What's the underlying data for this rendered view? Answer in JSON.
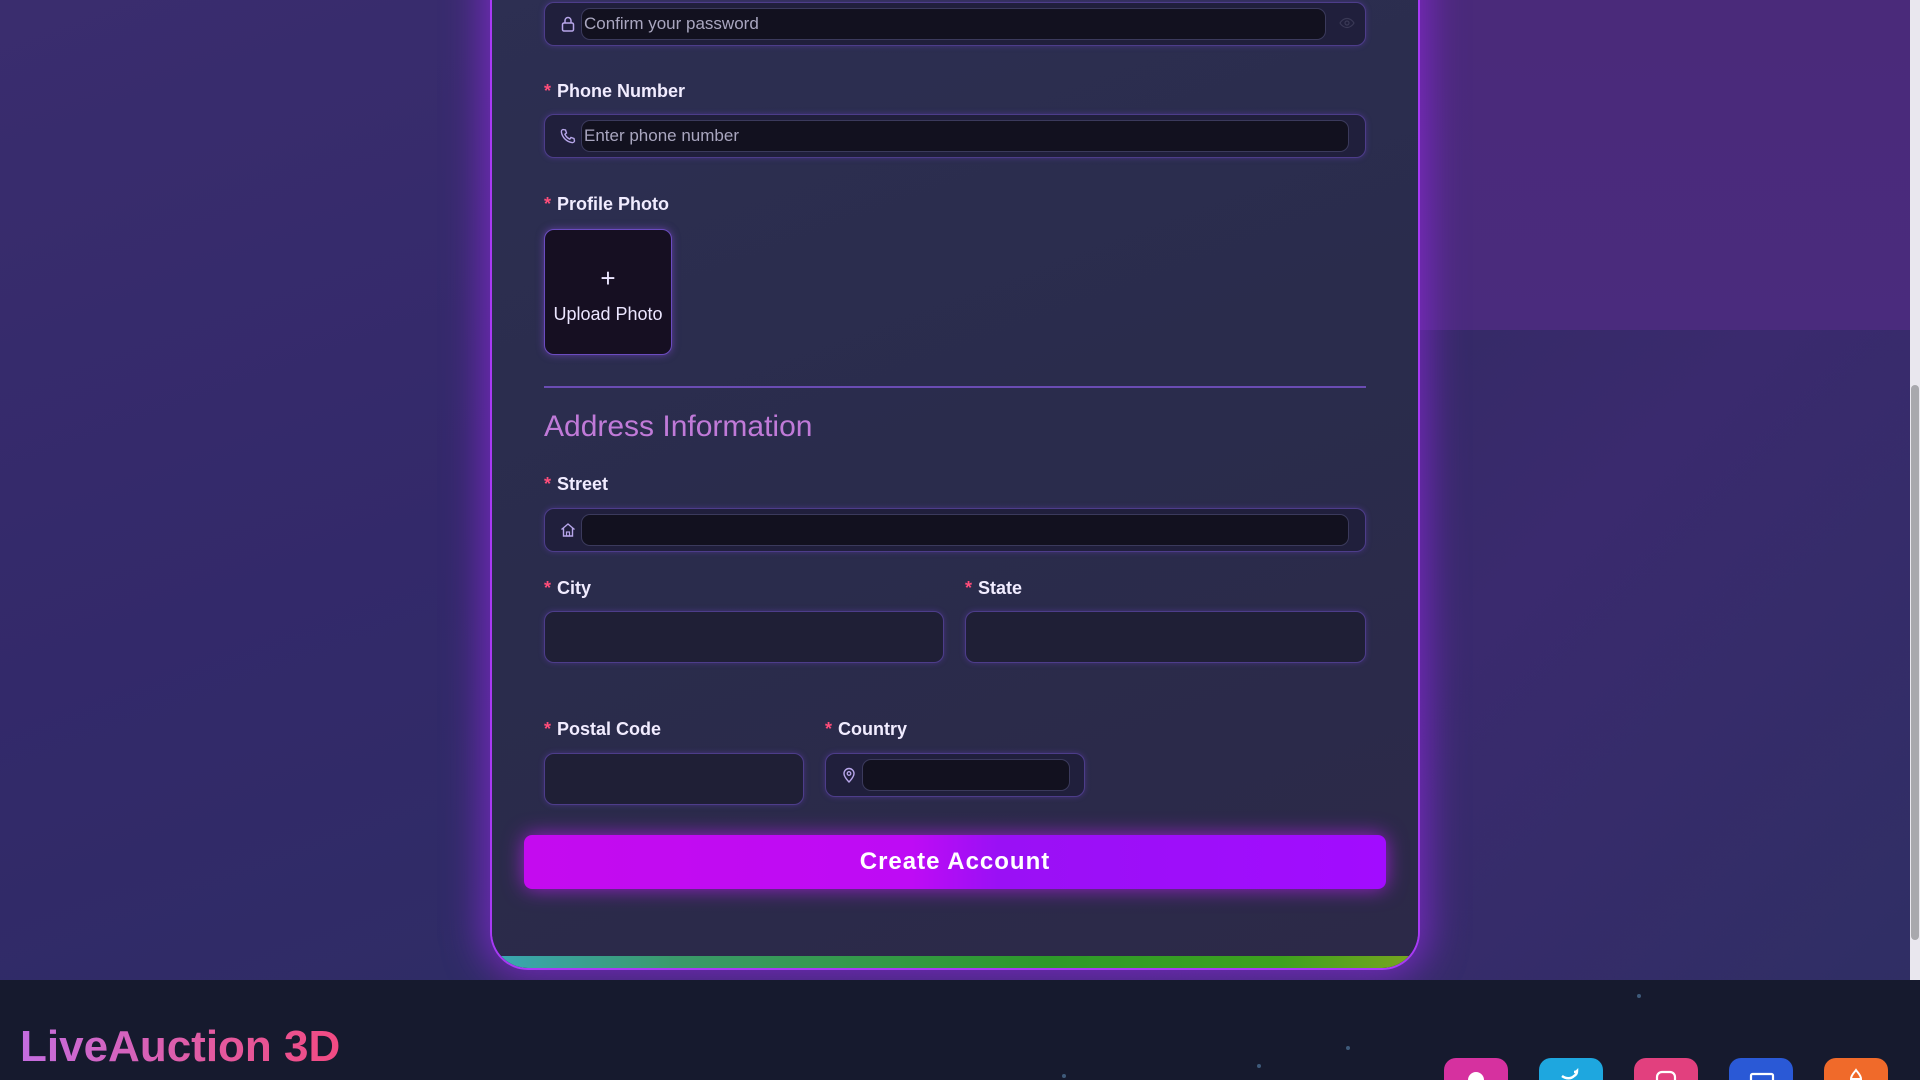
{
  "password_confirm": {
    "placeholder": "Confirm your password",
    "icon": "lock-icon"
  },
  "phone": {
    "label": "Phone Number",
    "placeholder": "Enter phone number",
    "icon": "phone-icon"
  },
  "profile_photo": {
    "label": "Profile Photo",
    "plus": "+",
    "upload_label": "Upload Photo"
  },
  "address": {
    "section_title": "Address Information",
    "street_label": "Street",
    "street_icon": "home-icon",
    "city_label": "City",
    "state_label": "State",
    "postal_label": "Postal Code",
    "country_label": "Country",
    "country_icon": "map-pin-icon"
  },
  "required_marker": "*",
  "submit": {
    "label": "Create Account"
  },
  "footer": {
    "brand": "LiveAuction 3D",
    "socials": [
      {
        "name": "reddit-icon",
        "color": "#d6319f"
      },
      {
        "name": "twitter-icon",
        "color": "#1ea7df"
      },
      {
        "name": "instagram-icon",
        "color": "#e2407e"
      },
      {
        "name": "mail-icon",
        "color": "#2a59d6"
      },
      {
        "name": "fire-icon",
        "color": "#f06a2a"
      }
    ]
  },
  "colors": {
    "accent": "#b91cff",
    "required": "#ff4d7a",
    "section_title": "#c07ad8"
  }
}
